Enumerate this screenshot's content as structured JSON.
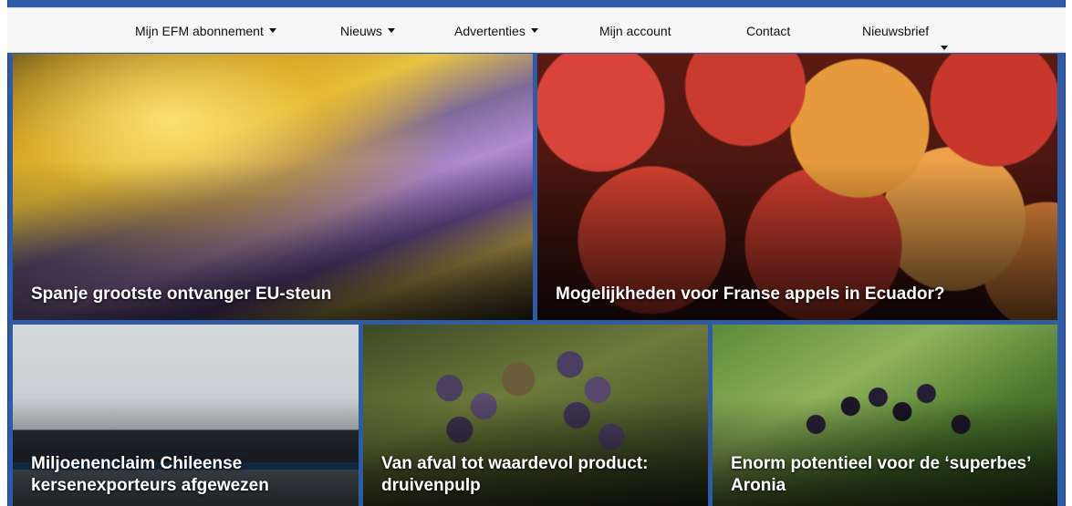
{
  "nav": {
    "items": [
      {
        "label": "Mijn EFM abonnement",
        "dropdown": true
      },
      {
        "label": "Nieuws",
        "dropdown": true
      },
      {
        "label": "Advertenties",
        "dropdown": true
      },
      {
        "label": "Mijn account",
        "dropdown": false
      },
      {
        "label": "Contact",
        "dropdown": false
      },
      {
        "label": "Nieuwsbrief",
        "dropdown": true
      }
    ]
  },
  "articles": {
    "featured": [
      {
        "headline": "Spanje grootste ontvanger EU-steun",
        "image": "euro-banknotes-photo"
      },
      {
        "headline": "Mogelijkheden voor Franse appels in Ecuador?",
        "image": "apples-photo"
      }
    ],
    "secondary": [
      {
        "headline": "Miljoenenclaim Chileense kersenexporteurs afgewezen",
        "image": "container-ship-photo"
      },
      {
        "headline": "Van afval tot waardevol product: druivenpulp",
        "image": "grapes-photo"
      },
      {
        "headline": "Enorm potentieel voor de ‘superbes’ Aronia",
        "image": "aronia-berries-photo"
      }
    ]
  },
  "colors": {
    "frame": "#2f5aa6",
    "nav_background": "#f7f7f7",
    "headline_text": "#ffffff"
  }
}
